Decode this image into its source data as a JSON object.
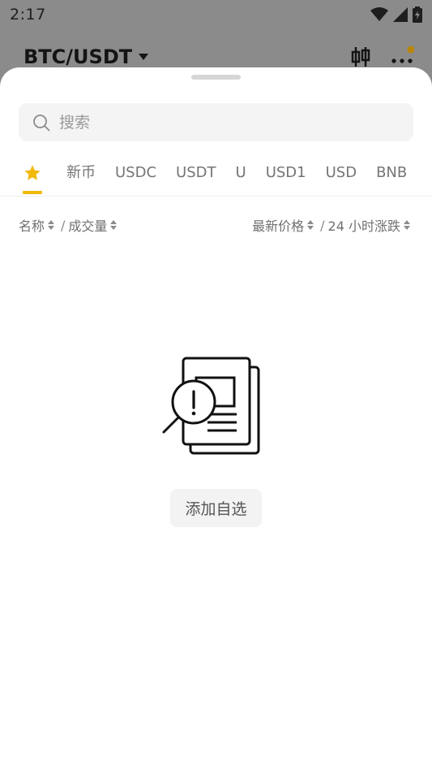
{
  "status_bar": {
    "time": "2:17"
  },
  "background_header": {
    "pair": "BTC/USDT"
  },
  "search": {
    "placeholder": "搜索",
    "value": ""
  },
  "tabs": [
    {
      "label": "",
      "icon": "star-icon",
      "active": true
    },
    {
      "label": "新币"
    },
    {
      "label": "USDC"
    },
    {
      "label": "USDT"
    },
    {
      "label": "U"
    },
    {
      "label": "USD1"
    },
    {
      "label": "USD"
    },
    {
      "label": "BNB"
    }
  ],
  "columns": {
    "name": "名称",
    "volume": "成交量",
    "price": "最新价格",
    "change": "24 小时涨跌",
    "separator": "/"
  },
  "empty_state": {
    "button_label": "添加自选",
    "icon": "no-results-document-icon"
  },
  "colors": {
    "accent": "#f0b90b",
    "text_primary": "#141414",
    "text_secondary": "#757575"
  }
}
